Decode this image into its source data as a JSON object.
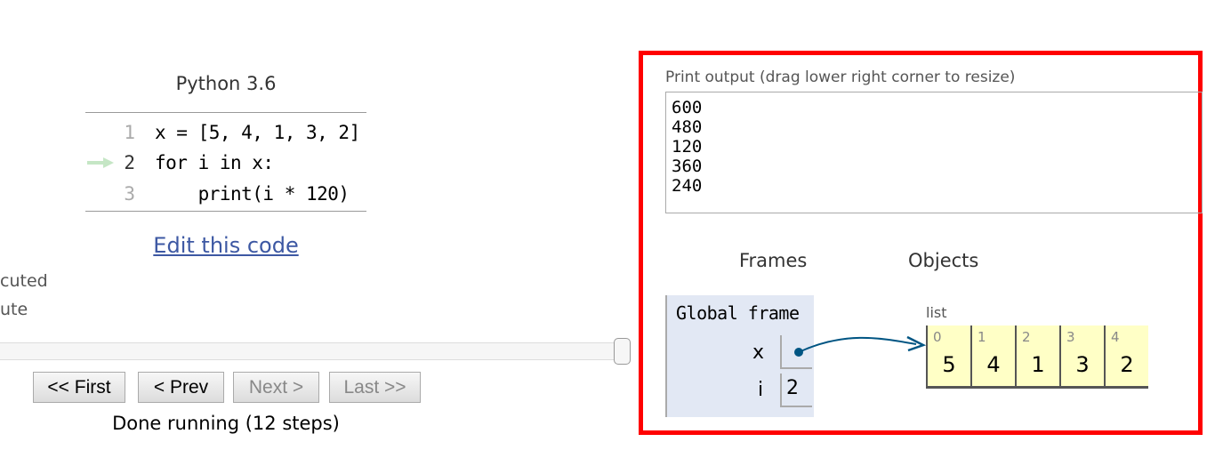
{
  "left": {
    "language": "Python 3.6",
    "code_lines": [
      {
        "num": "1",
        "text": "x = [5, 4, 1, 3, 2]"
      },
      {
        "num": "2",
        "text": "for i in x:"
      },
      {
        "num": "3",
        "text": "    print(i * 120)"
      }
    ],
    "current_line": 2,
    "edit_link": "Edit this code",
    "legend": [
      "cuted",
      "ute"
    ],
    "slider_progress": 1.0,
    "buttons": {
      "first": "<< First",
      "prev": "< Prev",
      "next": "Next >",
      "last": "Last >>"
    },
    "status": "Done running (12 steps)",
    "arrow_color": "#c5e6c5"
  },
  "right": {
    "print_label": "Print output (drag lower right corner to resize)",
    "output_lines": [
      "600",
      "480",
      "120",
      "360",
      "240"
    ],
    "frames_header": "Frames",
    "objects_header": "Objects",
    "global_frame": {
      "title": "Global frame",
      "vars": [
        {
          "name": "x",
          "value": "pointer"
        },
        {
          "name": "i",
          "value": "2"
        }
      ]
    },
    "list": {
      "label": "list",
      "indices": [
        "0",
        "1",
        "2",
        "3",
        "4"
      ],
      "values": [
        "5",
        "4",
        "1",
        "3",
        "2"
      ]
    },
    "highlight_color": "#ff0000",
    "pointer_color": "#005583"
  }
}
